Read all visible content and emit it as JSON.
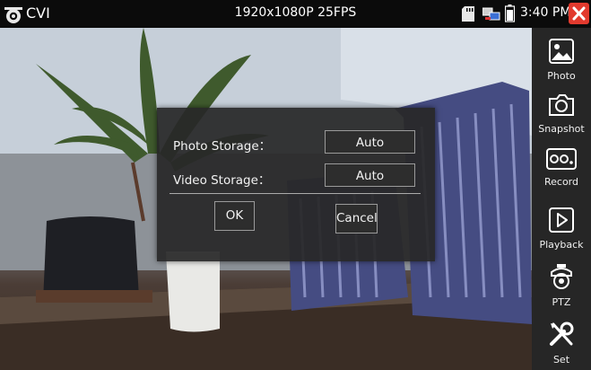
{
  "status_bar": {
    "app_name": "CVI",
    "resolution": "1920x1080P 25FPS",
    "time": "3:40 PM"
  },
  "sidebar": {
    "items": [
      {
        "label": "Photo",
        "icon": "image-icon"
      },
      {
        "label": "Snapshot",
        "icon": "camera-icon"
      },
      {
        "label": "Record",
        "icon": "video-record-icon"
      },
      {
        "label": "Playback",
        "icon": "play-icon"
      },
      {
        "label": "PTZ",
        "icon": "ptz-camera-icon"
      },
      {
        "label": "Set",
        "icon": "tools-icon"
      }
    ]
  },
  "dialog": {
    "photo_storage_label": "Photo Storage：",
    "photo_storage_value": "Auto",
    "video_storage_label": "Video Storage：",
    "video_storage_value": "Auto",
    "ok_label": "OK",
    "cancel_label": "Cancel"
  },
  "colors": {
    "close_button": "#e23a2e",
    "sidebar_bg": "#262626",
    "status_bar_bg": "#0b0b0b",
    "dialog_bg": "#282828"
  }
}
